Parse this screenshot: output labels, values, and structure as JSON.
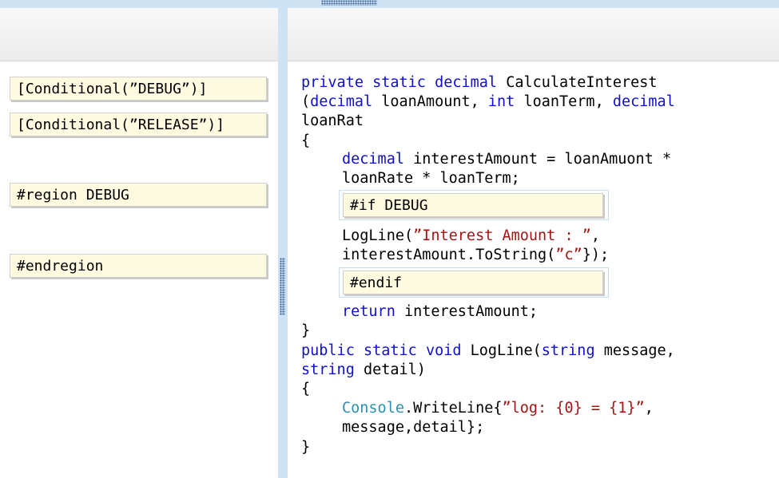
{
  "tokens": [
    {
      "text": "[Conditional(”DEBUG”)]"
    },
    {
      "text": "[Conditional(”RELEASE”)]"
    },
    {
      "text": "#region DEBUG"
    },
    {
      "text": "#endregion"
    }
  ],
  "targets": [
    {
      "text": "#if DEBUG"
    },
    {
      "text": "#endif"
    }
  ],
  "code": {
    "l1": {
      "a": "private",
      "b": "static",
      "c": "decimal",
      "d": "CalculateInterest"
    },
    "l2": {
      "a": "(",
      "b": "decimal",
      "c": " loanAmount, ",
      "d": "int",
      "e": " loanTerm, ",
      "f": "decimal"
    },
    "l3": "loanRat",
    "l4": "{",
    "l5": {
      "a": "decimal",
      "b": " interestAmount = loanAmuont *"
    },
    "l6": "loanRate * loanTerm;",
    "l7": {
      "a": "LogLine(",
      "b": "”Interest Amount : ”",
      "c": ","
    },
    "l8": {
      "a": "interestAmount.ToString(",
      "b": "”c”",
      "c": "});"
    },
    "l9": {
      "a": "return",
      "b": " interestAmount;"
    },
    "l10": "}",
    "l11": {
      "a": "public",
      "b": "static",
      "c": "void",
      "d": "LogLine(",
      "e": "string",
      "f": " message,"
    },
    "l12": {
      "a": "string",
      "b": " detail)"
    },
    "l13": "{",
    "l14": {
      "a": "Console",
      "b": ".WriteLine{",
      "c": "”log: {0} = {1}”",
      "d": ","
    },
    "l15": "message,detail};",
    "l16": "}"
  }
}
